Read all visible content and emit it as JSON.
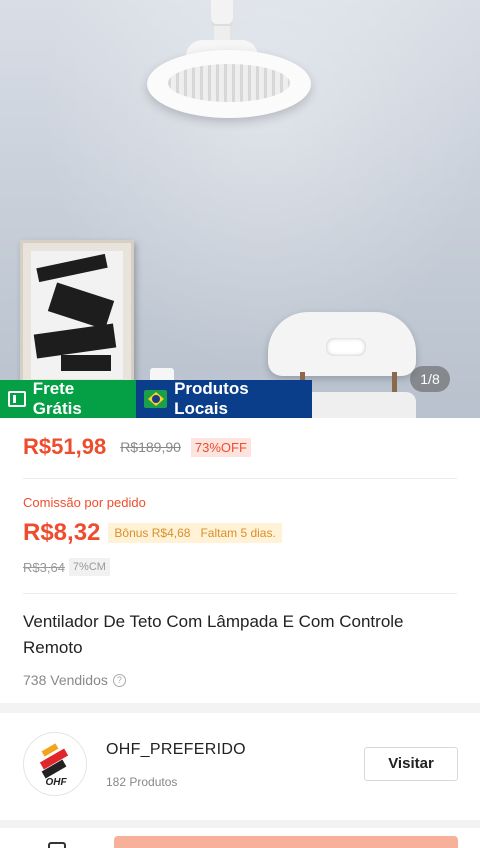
{
  "hero": {
    "image_counter": "1/8"
  },
  "badges": {
    "free_shipping": "Frete Grátis",
    "local_products": "Produtos Locais"
  },
  "price": {
    "current": "R$51,98",
    "original": "R$189,90",
    "discount": "73%OFF"
  },
  "commission": {
    "label": "Comissão por pedido",
    "value": "R$8,32",
    "bonus": "Bônus R$4,68",
    "deadline": "Faltam 5 dias.",
    "old_value": "R$3,64",
    "rate": "7%CM"
  },
  "product": {
    "title": "Ventilador De Teto Com Lâmpada E Com Controle Remoto",
    "sold": "738 Vendidos"
  },
  "shop": {
    "logo_text": "OHF",
    "name": "OHF_PREFERIDO",
    "product_count": "182 Produtos",
    "visit_label": "Visitar"
  },
  "colors": {
    "accent": "#ee4d2d",
    "free_shipping_bg": "#05a046",
    "local_products_bg": "#0b3e8a",
    "bonus_bg": "#fff2d6"
  },
  "icons": {
    "free_shipping": "truck-icon",
    "local_products": "brazil-flag-icon",
    "sold_help": "help-circle-icon"
  }
}
